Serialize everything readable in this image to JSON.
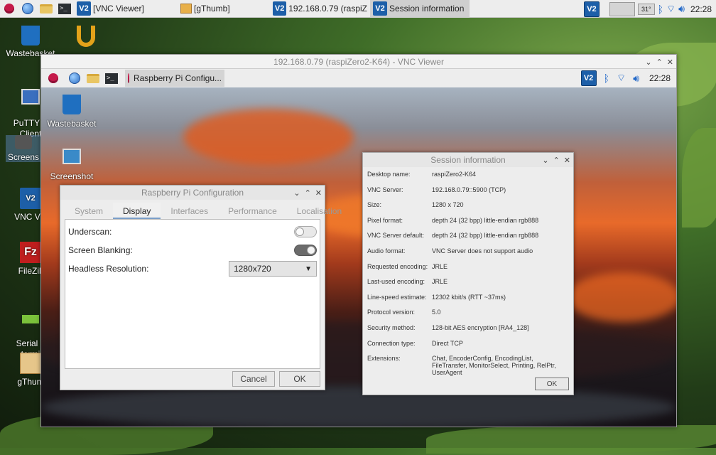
{
  "taskbar": {
    "tasks": [
      {
        "label": "[VNC Viewer]"
      },
      {
        "label": "[gThumb]"
      },
      {
        "label": "192.168.0.79 (raspiZ"
      },
      {
        "label": "Session information"
      }
    ],
    "vnc_icon": "V2",
    "temperature": "31°",
    "clock": "22:28"
  },
  "desktop_icons": [
    {
      "label": "Wastebasket"
    },
    {
      "label": "PuTTY S\nClient"
    },
    {
      "label": "Screens"
    },
    {
      "label": "VNC Vie"
    },
    {
      "label": "FileZill"
    },
    {
      "label": "Serial p\ntermi"
    },
    {
      "label": "gThum"
    }
  ],
  "vnc_window": {
    "title": "192.168.0.79 (raspiZero2-K64) - VNC Viewer",
    "remote_task": "Raspberry Pi Configu...",
    "remote_clock": "22:28",
    "remote_desktop_icons": [
      {
        "label": "Wastebasket"
      },
      {
        "label": "Screenshot"
      }
    ]
  },
  "rpi_config": {
    "title": "Raspberry Pi Configuration",
    "tabs": [
      "System",
      "Display",
      "Interfaces",
      "Performance",
      "Localisation"
    ],
    "selected_tab": "Display",
    "underscan_label": "Underscan:",
    "underscan_on": false,
    "blanking_label": "Screen Blanking:",
    "blanking_on": true,
    "headless_label": "Headless Resolution:",
    "headless_value": "1280x720",
    "cancel": "Cancel",
    "ok": "OK"
  },
  "session_info": {
    "title": "Session information",
    "rows": [
      {
        "k": "Desktop name:",
        "v": "raspiZero2-K64"
      },
      {
        "k": "VNC Server:",
        "v": "192.168.0.79::5900 (TCP)"
      },
      {
        "k": "Size:",
        "v": "1280 x 720"
      },
      {
        "k": "Pixel format:",
        "v": "depth 24 (32 bpp) little-endian rgb888"
      },
      {
        "k": "VNC Server default:",
        "v": "depth 24 (32 bpp) little-endian rgb888"
      },
      {
        "k": "Audio format:",
        "v": "VNC Server does not support audio"
      },
      {
        "k": "Requested encoding:",
        "v": "JRLE"
      },
      {
        "k": "Last-used encoding:",
        "v": "JRLE"
      },
      {
        "k": "Line-speed estimate:",
        "v": "12302 kbit/s (RTT ~37ms)"
      },
      {
        "k": "Protocol version:",
        "v": "5.0"
      },
      {
        "k": "Security method:",
        "v": "128-bit AES encryption [RA4_128]"
      },
      {
        "k": "Connection type:",
        "v": "Direct TCP"
      },
      {
        "k": "Extensions:",
        "v": "Chat, EncoderConfig, EncodingList, FileTransfer, MonitorSelect, Printing, RelPtr, UserAgent"
      }
    ],
    "ok": "OK"
  }
}
